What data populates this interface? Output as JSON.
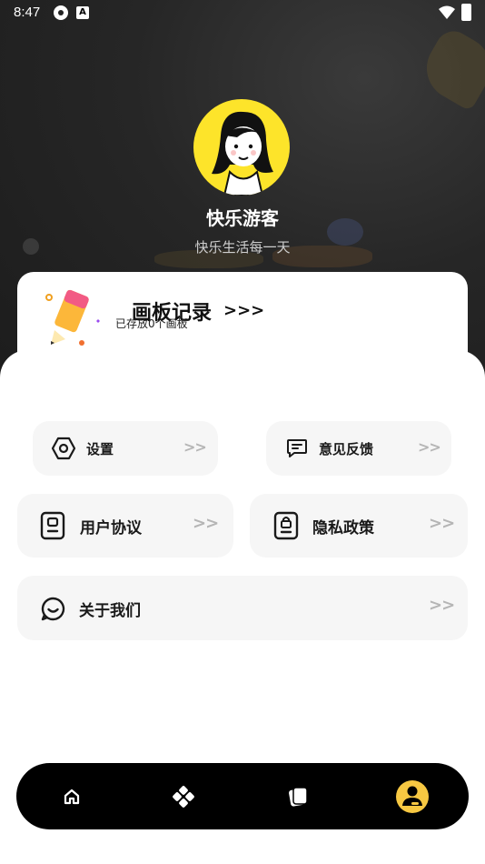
{
  "status_bar": {
    "time": "8:47",
    "notification_icons": [
      "photo-icon",
      "a-badge-icon"
    ],
    "system_icons": [
      "wifi-icon",
      "battery-icon"
    ]
  },
  "profile": {
    "username": "快乐游客",
    "motto": "快乐生活每一天"
  },
  "record": {
    "title": "画板记录",
    "arrow": ">>>",
    "subtitle": "已存放0个画板"
  },
  "menu": {
    "settings": {
      "label": "设置",
      "arrow": ">>",
      "icon": "hexagon-gear-icon"
    },
    "feedback": {
      "label": "意见反馈",
      "arrow": ">>",
      "icon": "chat-icon"
    },
    "agreement": {
      "label": "用户协议",
      "arrow": ">>",
      "icon": "document-user-icon"
    },
    "privacy": {
      "label": "隐私政策",
      "arrow": ">>",
      "icon": "lock-document-icon"
    },
    "about": {
      "label": "关于我们",
      "arrow": ">>",
      "icon": "smile-chat-icon"
    }
  },
  "bottom_nav": {
    "items": [
      "home-icon",
      "shapes-icon",
      "cards-icon",
      "profile-icon"
    ],
    "active": "profile-icon",
    "active_color": "#f7c842"
  },
  "colors": {
    "accent": "#fde42a",
    "card_bg": "#f6f6f6",
    "hero_bg": "#262626"
  }
}
